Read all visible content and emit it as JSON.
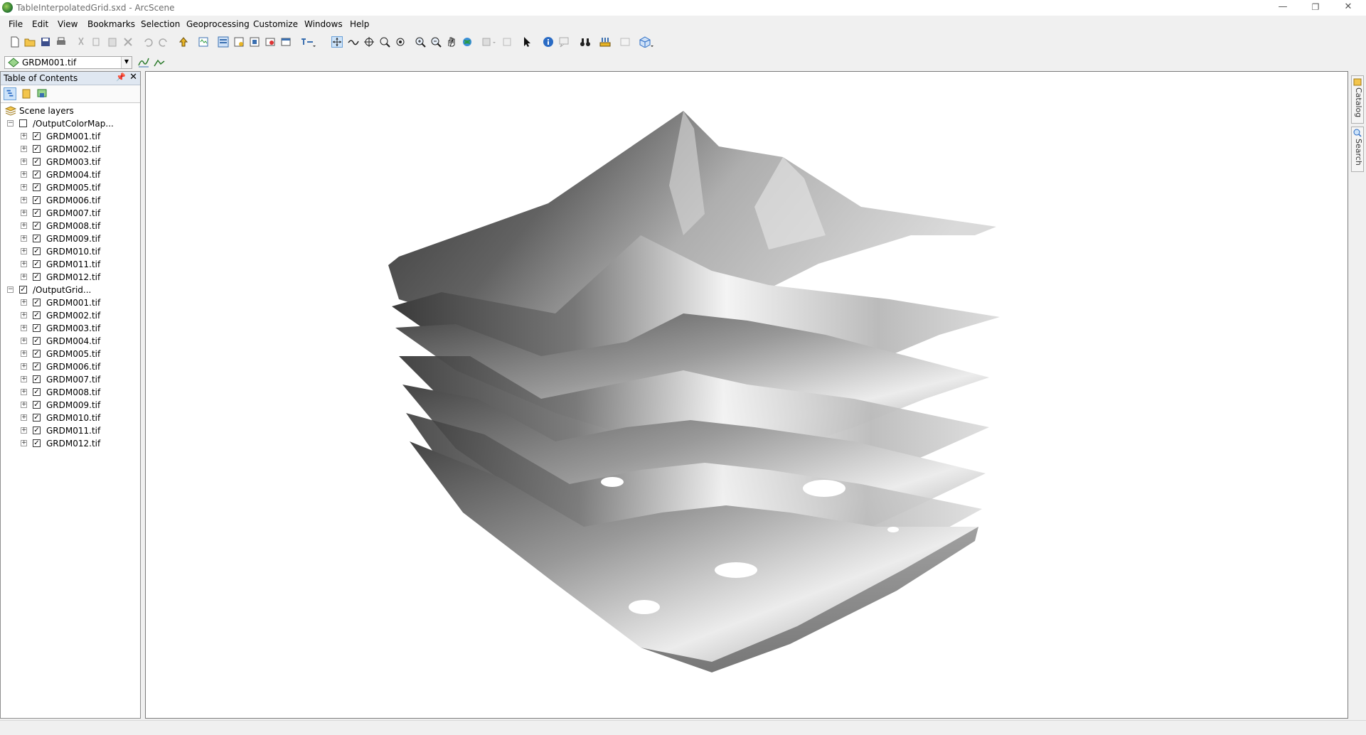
{
  "window": {
    "title": "TableInterpolatedGrid.sxd - ArcScene",
    "minimize": "—",
    "restore": "❐",
    "close": "✕"
  },
  "menu": [
    "File",
    "Edit",
    "View",
    "Bookmarks",
    "Selection",
    "Geoprocessing",
    "Customize",
    "Windows",
    "Help"
  ],
  "layer_selector": {
    "value": "GRDM001.tif"
  },
  "toc": {
    "title": "Table of Contents",
    "root": "Scene layers",
    "groups": [
      {
        "name": "/OutputColorMap...",
        "checked": false,
        "layers": [
          "GRDM001.tif",
          "GRDM002.tif",
          "GRDM003.tif",
          "GRDM004.tif",
          "GRDM005.tif",
          "GRDM006.tif",
          "GRDM007.tif",
          "GRDM008.tif",
          "GRDM009.tif",
          "GRDM010.tif",
          "GRDM011.tif",
          "GRDM012.tif"
        ]
      },
      {
        "name": "/OutputGrid...",
        "checked": true,
        "layers": [
          "GRDM001.tif",
          "GRDM002.tif",
          "GRDM003.tif",
          "GRDM004.tif",
          "GRDM005.tif",
          "GRDM006.tif",
          "GRDM007.tif",
          "GRDM008.tif",
          "GRDM009.tif",
          "GRDM010.tif",
          "GRDM011.tif",
          "GRDM012.tif"
        ]
      }
    ]
  },
  "right_tabs": [
    "Catalog",
    "Search"
  ],
  "toolbar_icons": [
    "new-document-icon",
    "open-folder-icon",
    "save-icon",
    "print-icon",
    "cut-icon",
    "copy-icon",
    "paste-icon",
    "delete-icon",
    "undo-icon",
    "redo-icon",
    "add-data-icon",
    "toc-icon",
    "scene-layer-icon",
    "layer-properties-icon",
    "render-icon",
    "window-icon",
    "editor-tool-icon",
    "navigate-icon",
    "fly-icon",
    "center-target-icon",
    "zoom-to-target-icon",
    "set-observer-icon",
    "zoom-in-icon",
    "zoom-out-icon",
    "pan-icon",
    "full-extent-icon",
    "select-features-icon",
    "clear-selection-icon",
    "select-elements-icon",
    "identify-icon",
    "html-popup-icon",
    "find-icon",
    "measure-icon",
    "animation-icon",
    "3d-effects-icon"
  ],
  "toolbar2_icons": [
    "surface-profile-icon",
    "line-of-sight-icon"
  ]
}
